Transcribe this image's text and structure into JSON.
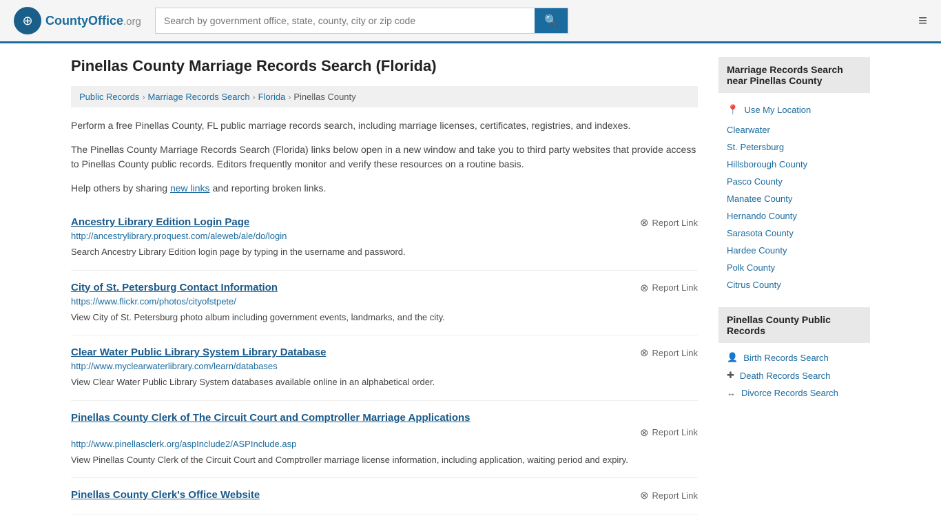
{
  "header": {
    "logo_text": "CountyOffice",
    "logo_suffix": ".org",
    "search_placeholder": "Search by government office, state, county, city or zip code",
    "search_icon": "🔍",
    "menu_icon": "≡"
  },
  "page": {
    "title": "Pinellas County Marriage Records Search (Florida)"
  },
  "breadcrumb": {
    "items": [
      "Public Records",
      "Marriage Records Search",
      "Florida",
      "Pinellas County"
    ]
  },
  "description": {
    "para1": "Perform a free Pinellas County, FL public marriage records search, including marriage licenses, certificates, registries, and indexes.",
    "para2": "The Pinellas County Marriage Records Search (Florida) links below open in a new window and take you to third party websites that provide access to Pinellas County public records. Editors frequently monitor and verify these resources on a routine basis.",
    "para3_start": "Help others by sharing ",
    "para3_link": "new links",
    "para3_end": " and reporting broken links."
  },
  "results": [
    {
      "title": "Ancestry Library Edition Login Page",
      "url": "http://ancestrylibrary.proquest.com/aleweb/ale/do/login",
      "desc": "Search Ancestry Library Edition login page by typing in the username and password."
    },
    {
      "title": "City of St. Petersburg Contact Information",
      "url": "https://www.flickr.com/photos/cityofstpete/",
      "desc": "View City of St. Petersburg photo album including government events, landmarks, and the city."
    },
    {
      "title": "Clear Water Public Library System Library Database",
      "url": "http://www.myclearwaterlibrary.com/learn/databases",
      "desc": "View Clear Water Public Library System databases available online in an alphabetical order."
    },
    {
      "title": "Pinellas County Clerk of The Circuit Court and Comptroller Marriage Applications",
      "url": "http://www.pinellasclerk.org/aspInclude2/ASPInclude.asp",
      "desc": "View Pinellas County Clerk of the Circuit Court and Comptroller marriage license information, including application, waiting period and expiry."
    },
    {
      "title": "Pinellas County Clerk's Office Website",
      "url": "",
      "desc": ""
    }
  ],
  "report_link_label": "Report Link",
  "sidebar": {
    "nearby_heading": "Marriage Records Search near Pinellas County",
    "use_location_label": "Use My Location",
    "nearby_links": [
      "Clearwater",
      "St. Petersburg",
      "Hillsborough County",
      "Pasco County",
      "Manatee County",
      "Hernando County",
      "Sarasota County",
      "Hardee County",
      "Polk County",
      "Citrus County"
    ],
    "public_records_heading": "Pinellas County Public Records",
    "public_records_links": [
      {
        "label": "Birth Records Search",
        "icon": "👤"
      },
      {
        "label": "Death Records Search",
        "icon": "✚"
      },
      {
        "label": "Divorce Records Search",
        "icon": "↔"
      }
    ]
  }
}
